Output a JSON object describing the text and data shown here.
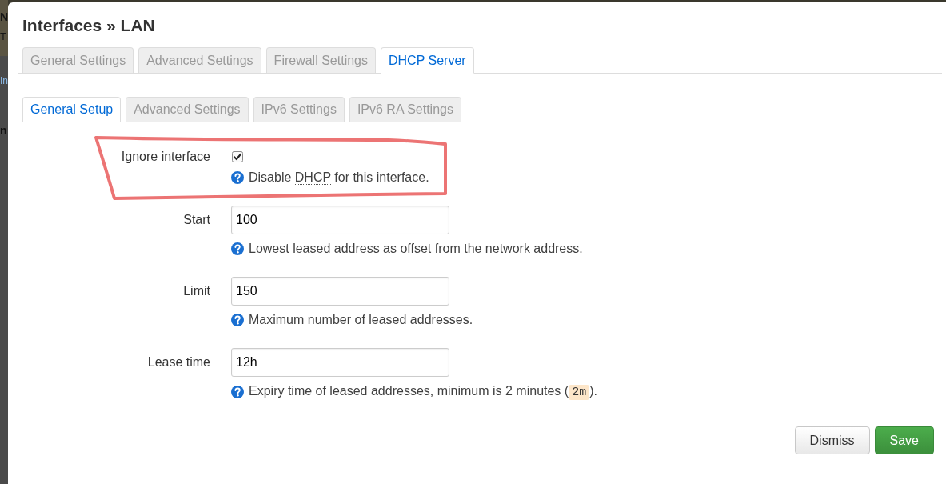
{
  "backdrop": {
    "texts": [
      {
        "kind": "heading",
        "text": "N"
      },
      {
        "kind": "subtitle",
        "text": "T"
      },
      {
        "kind": "link",
        "text": "In"
      },
      {
        "kind": "section-heading",
        "text": "n"
      }
    ]
  },
  "dialog": {
    "title": "Interfaces » LAN",
    "tabs": [
      {
        "label": "General Settings",
        "selected": false
      },
      {
        "label": "Advanced Settings",
        "selected": false
      },
      {
        "label": "Firewall Settings",
        "selected": false
      },
      {
        "label": "DHCP Server",
        "selected": true
      }
    ],
    "subtabs": [
      {
        "label": "General Setup",
        "selected": true
      },
      {
        "label": "Advanced Settings",
        "selected": false
      },
      {
        "label": "IPv6 Settings",
        "selected": false
      },
      {
        "label": "IPv6 RA Settings",
        "selected": false
      }
    ],
    "fields": [
      {
        "kind": "checkbox",
        "label": "Ignore interface",
        "checked": true,
        "highlighted": true,
        "help": [
          {
            "kind": "text",
            "text": "Disable "
          },
          {
            "kind": "abbr",
            "text": "DHCP"
          },
          {
            "kind": "text",
            "text": " for this interface."
          }
        ]
      },
      {
        "kind": "text",
        "label": "Start",
        "value": "100",
        "highlighted": false,
        "help": [
          {
            "kind": "text",
            "text": "Lowest leased address as offset from the network address."
          }
        ]
      },
      {
        "kind": "text",
        "label": "Limit",
        "value": "150",
        "highlighted": false,
        "help": [
          {
            "kind": "text",
            "text": "Maximum number of leased addresses."
          }
        ]
      },
      {
        "kind": "text",
        "label": "Lease time",
        "value": "12h",
        "highlighted": false,
        "help": [
          {
            "kind": "text",
            "text": "Expiry time of leased addresses, minimum is 2 minutes ("
          },
          {
            "kind": "code",
            "text": "2m"
          },
          {
            "kind": "text",
            "text": ")."
          }
        ]
      }
    ],
    "buttons": [
      {
        "label": "Dismiss",
        "kind": "default"
      },
      {
        "label": "Save",
        "kind": "primary"
      }
    ]
  }
}
